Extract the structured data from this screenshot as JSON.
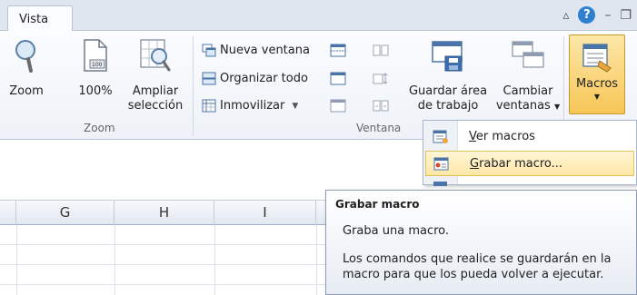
{
  "tabs": {
    "active": "Vista"
  },
  "window": {
    "help": "?"
  },
  "ribbon": {
    "zoom_group": {
      "label": "Zoom",
      "zoom": "Zoom",
      "hundred": "100%",
      "ampliar_line1": "Ampliar",
      "ampliar_line2": "selección"
    },
    "ventana_group": {
      "label": "Ventana",
      "nueva_ventana": "Nueva ventana",
      "organizar_todo": "Organizar todo",
      "inmovilizar": "Inmovilizar",
      "guardar_line1": "Guardar área",
      "guardar_line2": "de trabajo",
      "cambiar_line1": "Cambiar",
      "cambiar_line2": "ventanas"
    },
    "macros": {
      "label": "Macros"
    }
  },
  "menu": {
    "items": [
      {
        "label": "Ver macros",
        "accel": "V",
        "rest": "er macros",
        "highlighted": false
      },
      {
        "label": "Grabar macro...",
        "accel": "G",
        "rest": "rabar macro...",
        "highlighted": true
      }
    ]
  },
  "sheet": {
    "columns": [
      "G",
      "H",
      "I"
    ]
  },
  "tooltip": {
    "title": "Grabar macro",
    "line1": "Graba una macro.",
    "line2": "Los comandos que realice se guardarán en la macro para que los pueda volver a ejecutar."
  },
  "colors": {
    "accent": "#f7c657",
    "ribbon_border": "#b9c4d2",
    "help_blue": "#2f7fd1"
  }
}
